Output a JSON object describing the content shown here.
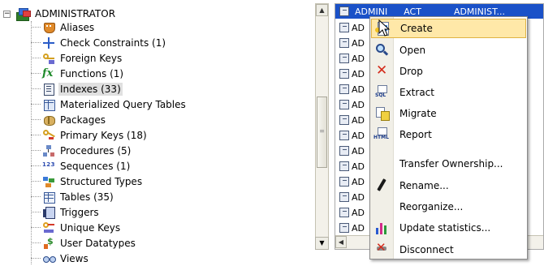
{
  "tree": {
    "root_label": "ADMINISTRATOR",
    "expander": "−",
    "items": [
      {
        "label": "Aliases",
        "icon": "alias-mask-icon"
      },
      {
        "label": "Check Constraints (1)",
        "icon": "check-constraint-icon"
      },
      {
        "label": "Foreign Keys",
        "icon": "foreign-key-icon"
      },
      {
        "label": "Functions (1)",
        "icon": "function-fx-icon"
      },
      {
        "label": "Indexes (33)",
        "icon": "index-icon",
        "selected": true
      },
      {
        "label": "Materialized Query Tables",
        "icon": "mqt-icon"
      },
      {
        "label": "Packages",
        "icon": "package-icon"
      },
      {
        "label": "Primary Keys (18)",
        "icon": "primary-key-icon"
      },
      {
        "label": "Procedures (5)",
        "icon": "procedure-icon"
      },
      {
        "label": "Sequences (1)",
        "icon": "sequence-icon"
      },
      {
        "label": "Structured Types",
        "icon": "structured-type-icon"
      },
      {
        "label": "Tables (35)",
        "icon": "table-icon"
      },
      {
        "label": "Triggers",
        "icon": "trigger-icon"
      },
      {
        "label": "Unique Keys",
        "icon": "unique-key-icon"
      },
      {
        "label": "User Datatypes",
        "icon": "user-datatype-icon"
      },
      {
        "label": "Views",
        "icon": "view-icon"
      }
    ]
  },
  "grid": {
    "header": {
      "col1": "ADMINI",
      "col2": "ACT",
      "col3": "ADMINIST..."
    },
    "row_prefix": "AD",
    "row_count": 14
  },
  "context_menu": {
    "items": [
      {
        "label": "Create",
        "icon": "create-icon",
        "hover": true
      },
      {
        "label": "Open",
        "icon": "open-magnifier-icon"
      },
      {
        "label": "Drop",
        "icon": "drop-x-icon"
      },
      {
        "label": "Extract",
        "icon": "extract-sql-icon"
      },
      {
        "label": "Migrate",
        "icon": "migrate-icon"
      },
      {
        "label": "Report",
        "icon": "report-html-icon"
      },
      {
        "label": "Transfer Ownership...",
        "icon": ""
      },
      {
        "label": "Rename...",
        "icon": "rename-pencil-icon"
      },
      {
        "label": "Reorganize...",
        "icon": ""
      },
      {
        "label": "Update statistics...",
        "icon": "statistics-bar-icon"
      },
      {
        "label": "Disconnect",
        "icon": "disconnect-icon"
      }
    ]
  },
  "icon_text": {
    "sql": "SQL",
    "html": "HTML",
    "fx": "fx",
    "seq": "1 2 3",
    "dollar": "$"
  },
  "scroll": {
    "up": "▲",
    "down": "▼",
    "left": "◀",
    "grip": "≡"
  },
  "colors": {
    "grid_header": "#1a51c8",
    "menu_hover": "#ffe8a8",
    "menu_hover_border": "#e0b243",
    "tree_selection": "#e0e0e0"
  }
}
